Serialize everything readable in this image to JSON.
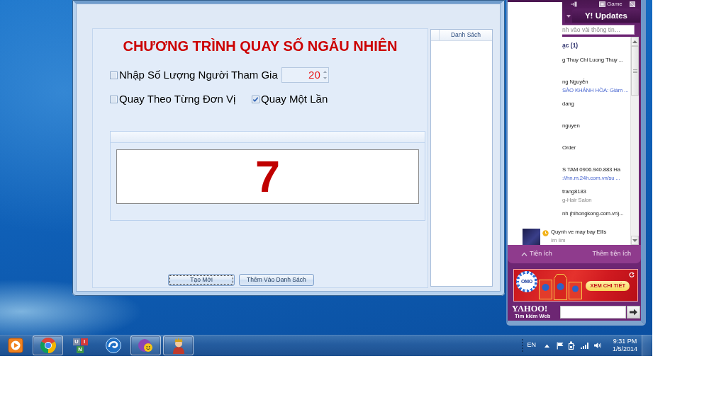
{
  "app_window": {
    "title": "CHƯƠNG TRÌNH QUAY SỐ NGẪU NHIÊN",
    "count_option": {
      "label": "Nhập Số Lượng Người Tham Gia",
      "checked": false,
      "value": "20"
    },
    "mode_options": [
      {
        "label": "Quay Theo Từng Đơn Vị",
        "checked": false
      },
      {
        "label": "Quay Một Lần",
        "checked": true
      }
    ],
    "result": "7",
    "buttons": [
      {
        "label": "Tạo Mới",
        "focused": true
      },
      {
        "label": "Thêm Vào Danh Sách",
        "focused": false
      }
    ],
    "list": {
      "columns": [
        "Danh Sách"
      ]
    }
  },
  "messenger": {
    "top_menu_label": "Game",
    "tabs": [
      {
        "label": "Y! Updates",
        "selected": false
      }
    ],
    "search": {
      "placeholder": "nh vào vài thông tin…"
    },
    "contacts": [
      {
        "kind": "group",
        "name": "ạc (1)"
      },
      {
        "kind": "clipped",
        "name": "g Thuy Chi Luong Thuy ..."
      },
      {
        "kind": "clipped",
        "name": "ng Nguyễn",
        "status": {
          "text": "SÀO KHÁNH HÒA: Giám ...",
          "kind": "link"
        }
      },
      {
        "kind": "clipped",
        "name": "dang"
      },
      {
        "kind": "clipped",
        "name": "nguyen"
      },
      {
        "kind": "clipped",
        "name": "Order"
      },
      {
        "kind": "clipped",
        "name": "S TAM 0906.940.883 Ha",
        "status": {
          "text": "://hn.m.24h.com.vn/su ...",
          "kind": "link"
        }
      },
      {
        "kind": "clipped",
        "name": "trang8183",
        "status": {
          "text": "g-Hair Salon",
          "kind": "plain"
        }
      },
      {
        "kind": "clipped",
        "name": "nh (hihongkong.com.vn)..."
      },
      {
        "kind": "full",
        "name": "Quynh ve may bay Ellis",
        "status": {
          "text": "Im lìm",
          "kind": "plain"
        }
      }
    ],
    "footer": {
      "left": "Tiện ích",
      "right": "Thêm tiện ích"
    },
    "ad": {
      "logo": "OMO",
      "button": "XEM CHI TIẾT"
    },
    "web_search": {
      "logo": "YAHOO!",
      "caption": "Tìm kiếm Web"
    }
  },
  "taskbar": {
    "apps": [
      {
        "kind": "media",
        "running": false
      },
      {
        "kind": "ring",
        "running": true
      },
      {
        "kind": "tiles",
        "running": false,
        "tiles": [
          {
            "letter": "U",
            "color": "#7b8aa6"
          },
          {
            "letter": "I",
            "color": "#d23a3a"
          },
          {
            "letter": "N",
            "color": "#3c9446"
          }
        ]
      },
      {
        "kind": "swirl",
        "running": false
      },
      {
        "kind": "smiley",
        "running": true
      },
      {
        "kind": "person",
        "running": true
      }
    ],
    "language": "EN",
    "time": "9:31 PM",
    "date": "1/5/2014"
  }
}
